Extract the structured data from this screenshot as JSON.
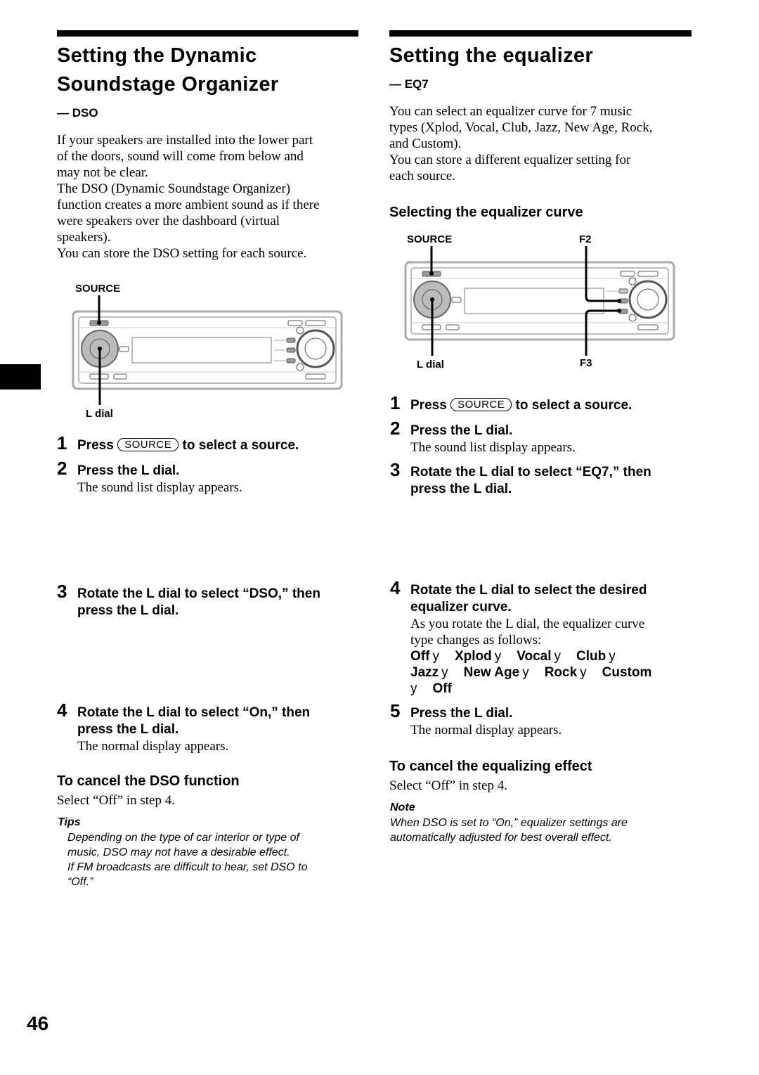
{
  "left": {
    "title_line1": "Setting the Dynamic",
    "title_line2": "Soundstage Organizer",
    "subtitle": "— DSO",
    "intro": [
      "If your speakers are installed into the lower part",
      "of the doors, sound will come from below and",
      "may not be clear.",
      "The DSO (Dynamic Soundstage Organizer)",
      "function creates a more ambient sound as if there",
      "were speakers over the dashboard (virtual",
      "speakers).",
      "You can store the DSO setting for each source."
    ],
    "diagram": {
      "source_label": "SOURCE",
      "ldial_label": "L dial"
    },
    "steps": [
      {
        "num": "1",
        "pre": "Press",
        "key": "SOURCE",
        "post": "to select a source."
      },
      {
        "num": "2",
        "text": "Press the L dial.",
        "desc": "The sound list display appears."
      },
      {
        "num": "3",
        "text_line1": "Rotate the L dial to select “DSO,” then",
        "text_line2": "press the L dial."
      },
      {
        "num": "4",
        "text_line1": "Rotate the L dial to select “On,” then",
        "text_line2": "press the L dial.",
        "desc": "The normal display appears."
      }
    ],
    "cancel_heading": "To cancel the DSO function",
    "cancel_text": "Select “Off” in step 4.",
    "tips_heading": "Tips",
    "tips": [
      "Depending on the type of car interior or type of",
      "music, DSO may not have a desirable effect.",
      "If FM broadcasts are difficult to hear, set DSO to",
      "“Off.”"
    ]
  },
  "right": {
    "title": "Setting the equalizer",
    "subtitle": "— EQ7",
    "intro": [
      "You can select an equalizer curve for 7 music",
      "types (Xplod, Vocal, Club, Jazz, New Age, Rock,",
      "and Custom).",
      "You can store a different equalizer setting for",
      "each source."
    ],
    "section_heading": "Selecting the equalizer curve",
    "diagram": {
      "source_label": "SOURCE",
      "f2_label": "F2",
      "ldial_label": "L dial",
      "f3_label": "F3"
    },
    "steps": [
      {
        "num": "1",
        "pre": "Press",
        "key": "SOURCE",
        "post": "to select a source."
      },
      {
        "num": "2",
        "text": "Press the L dial.",
        "desc": "The sound list display appears."
      },
      {
        "num": "3",
        "text_line1": "Rotate the L dial to select “EQ7,” then",
        "text_line2": "press the L dial."
      },
      {
        "num": "4",
        "text_line1": "Rotate the L dial to select the desired",
        "text_line2": "equalizer curve.",
        "desc_line1": "As you rotate the L dial, the equalizer curve",
        "desc_line2": "type changes as follows:"
      },
      {
        "num": "5",
        "text": "Press the L dial.",
        "desc": "The normal display appears."
      }
    ],
    "eq_sequence": [
      "Off",
      "Xplod",
      "Vocal",
      "Club",
      "Jazz",
      "New Age",
      "Rock",
      "Custom",
      "Off"
    ],
    "arrow_glyph": "y",
    "cancel_heading": "To cancel the equalizing effect",
    "cancel_text": "Select “Off” in step 4.",
    "note_heading": "Note",
    "note": [
      "When DSO is set to “On,” equalizer settings are",
      "automatically adjusted for best overall effect."
    ]
  },
  "page_number": "46"
}
